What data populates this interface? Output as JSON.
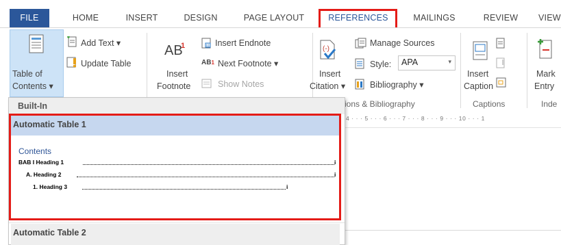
{
  "tabs": {
    "file": "FILE",
    "home": "HOME",
    "insert": "INSERT",
    "design": "DESIGN",
    "page_layout": "PAGE LAYOUT",
    "references": "REFERENCES",
    "mailings": "MAILINGS",
    "review": "REVIEW",
    "view": "VIEW"
  },
  "ribbon": {
    "toc": {
      "line1": "Table of",
      "line2": "Contents ▾",
      "add_text": "Add Text ▾",
      "update_table": "Update Table"
    },
    "footnotes": {
      "insert_footnote_1": "Insert",
      "insert_footnote_2": "Footnote",
      "ab_symbol": "AB",
      "insert_endnote": "Insert Endnote",
      "next_footnote": "Next Footnote  ▾",
      "show_notes": "Show Notes"
    },
    "citations": {
      "insert_citation_1": "Insert",
      "insert_citation_2": "Citation ▾",
      "manage_sources": "Manage Sources",
      "style_label": "Style:",
      "style_value": "APA",
      "bibliography": "Bibliography ▾",
      "group_label": "ions & Bibliography"
    },
    "captions": {
      "insert_caption_1": "Insert",
      "insert_caption_2": "Caption",
      "group_label": "Captions"
    },
    "index": {
      "mark_entry_1": "Mark",
      "mark_entry_2": "Entry",
      "group_label": "Inde"
    }
  },
  "ruler": "4 · · · 5 · · · 6 · · · 7 · · · 8 · · · 9 · · · 10 · · · 1",
  "gallery": {
    "section_header": "Built-In",
    "entry1_label": "Automatic Table 1",
    "entry2_label": "Automatic Table 2",
    "preview": {
      "heading": "Contents",
      "lines": [
        {
          "text": "BAB I    Heading 1",
          "page": "i"
        },
        {
          "text": "A.   Heading 2",
          "page": "i"
        },
        {
          "text": "1.   Heading 3",
          "page": "i"
        }
      ]
    }
  },
  "colors": {
    "accent": "#2b579a",
    "highlight": "#e41b17",
    "selected": "#c6d7ef"
  }
}
